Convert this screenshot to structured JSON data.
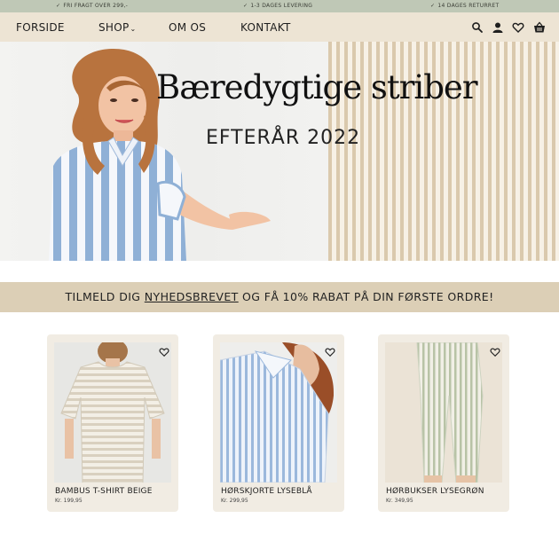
{
  "topbar": {
    "items": [
      "FRI FRAGT OVER 299,-",
      "1-3 DAGES LEVERING",
      "14 DAGES RETURRET"
    ]
  },
  "nav": {
    "links": [
      "FORSIDE",
      "SHOP",
      "OM OS",
      "KONTAKT"
    ],
    "icons": [
      "search-icon",
      "account-icon",
      "heart-icon",
      "basket-icon"
    ]
  },
  "hero": {
    "title": "Bæredygtige striber",
    "subtitle": "EFTERÅR 2022"
  },
  "newsletter": {
    "before": "TILMELD DIG",
    "link": "NYHEDSBREVET",
    "after": "OG FÅ 10% RABAT PÅ DIN FØRSTE ORDRE!"
  },
  "products": [
    {
      "name": "BAMBUS T-SHIRT BEIGE",
      "price": "Kr. 199,95"
    },
    {
      "name": "HØRSKJORTE LYSEBLÅ",
      "price": "Kr. 299,95"
    },
    {
      "name": "HØRBUKSER LYSEGRØN",
      "price": "Kr. 349,95"
    }
  ],
  "colors": {
    "topbar": "#bfc8b6",
    "nav": "#ede4d4",
    "newsletter": "#dccfb6",
    "card": "#f1ece3",
    "stripe_beige": "#dac9ad"
  }
}
